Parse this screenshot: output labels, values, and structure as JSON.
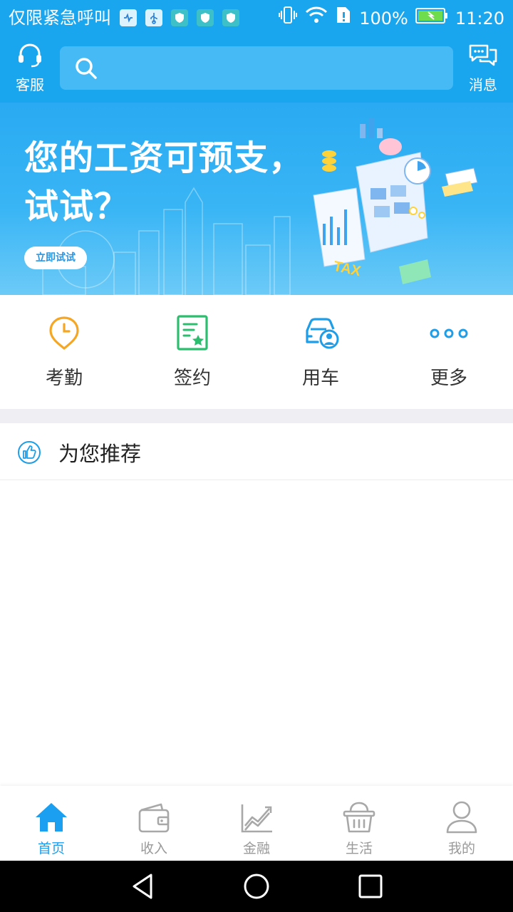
{
  "status_bar": {
    "carrier_text": "仅限紧急呼叫",
    "battery": "100%",
    "time": "11:20"
  },
  "header": {
    "service_label": "客服",
    "message_label": "消息",
    "search": {
      "placeholder": ""
    }
  },
  "banner": {
    "title_line1": "您的工资可预支，",
    "title_line2": "试试？",
    "cta_label": "立即试试",
    "graphic_text": "TAX"
  },
  "shortcuts": [
    {
      "label": "考勤",
      "icon": "clock-pin-icon",
      "color": "#f5a623"
    },
    {
      "label": "签约",
      "icon": "contract-star-icon",
      "color": "#2dbd6e"
    },
    {
      "label": "用车",
      "icon": "car-user-icon",
      "color": "#1e9ee8"
    },
    {
      "label": "更多",
      "icon": "more-dots-icon",
      "color": "#1e9ee8"
    }
  ],
  "recommend": {
    "title": "为您推荐"
  },
  "tabs": [
    {
      "label": "首页",
      "icon": "home-icon",
      "active": true
    },
    {
      "label": "收入",
      "icon": "wallet-icon",
      "active": false
    },
    {
      "label": "金融",
      "icon": "chart-trend-icon",
      "active": false
    },
    {
      "label": "生活",
      "icon": "basket-icon",
      "active": false
    },
    {
      "label": "我的",
      "icon": "user-icon",
      "active": false
    }
  ],
  "colors": {
    "primary": "#1aa5ef",
    "tab_active": "#1b9ff0",
    "tab_inactive": "#9a9a9a"
  }
}
